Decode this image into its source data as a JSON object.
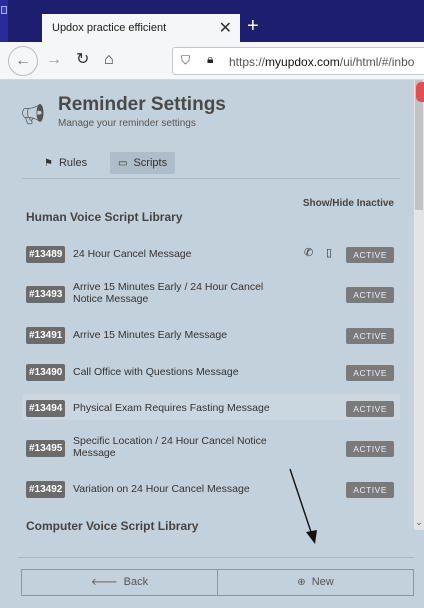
{
  "browser": {
    "tab_title": "Updox practice efficient",
    "tab_close": "✕",
    "new_tab": "+",
    "url_prefix": "https://",
    "url_domain": "myupdox.com",
    "url_path": "/ui/html/#/inbo"
  },
  "header": {
    "title": "Reminder Settings",
    "subtitle": "Manage your reminder settings"
  },
  "tabs": [
    {
      "label": "Rules"
    },
    {
      "label": "Scripts"
    }
  ],
  "library": {
    "show_hide": "Show/Hide Inactive",
    "human_title": "Human Voice Script Library",
    "computer_title": "Computer Voice Script Library",
    "status_label": "ACTIVE",
    "items": [
      {
        "id": "#13489",
        "name": "24 Hour Cancel Message"
      },
      {
        "id": "#13493",
        "name": "Arrive 15 Minutes Early / 24 Hour Cancel Notice Message"
      },
      {
        "id": "#13491",
        "name": "Arrive 15 Minutes Early Message"
      },
      {
        "id": "#13490",
        "name": "Call Office with Questions Message"
      },
      {
        "id": "#13494",
        "name": "Physical Exam Requires Fasting Message"
      },
      {
        "id": "#13495",
        "name": "Specific Location / 24 Hour Cancel Notice Message"
      },
      {
        "id": "#13492",
        "name": "Variation on 24 Hour Cancel Message"
      }
    ]
  },
  "footer": {
    "back_label": "Back",
    "new_label": "New"
  },
  "colors": {
    "page_bg": "#c3d1dc",
    "badge_bg": "#6b6b6b",
    "status_bg": "#7a7a7a"
  }
}
